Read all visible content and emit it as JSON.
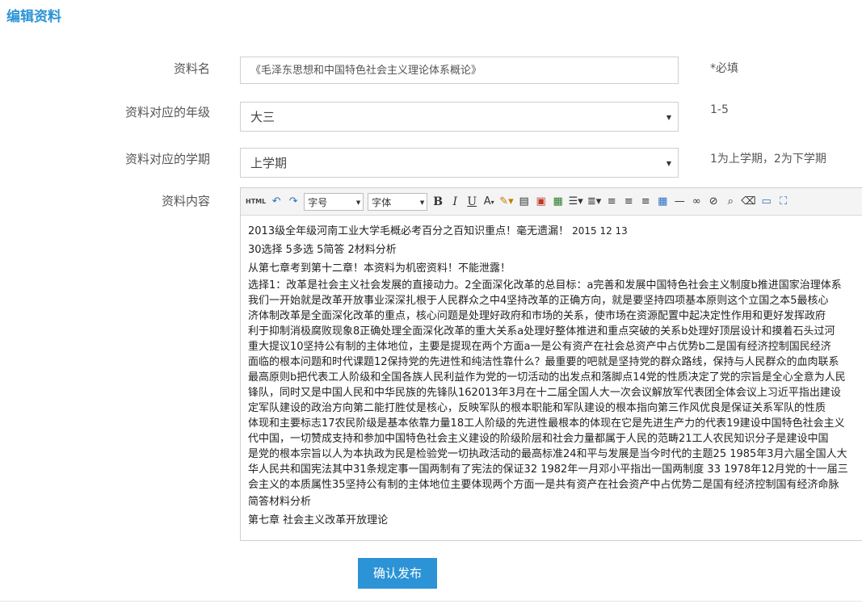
{
  "page": {
    "title": "编辑资料"
  },
  "form": {
    "name": {
      "label": "资料名",
      "value": "《毛泽东思想和中国特色社会主义理论体系概论》",
      "hint": "*必填"
    },
    "grade": {
      "label": "资料对应的年级",
      "value": "大三",
      "hint": "1-5"
    },
    "term": {
      "label": "资料对应的学期",
      "value": "上学期",
      "hint": "1为上学期，2为下学期"
    },
    "content": {
      "label": "资料内容"
    }
  },
  "editor": {
    "toolbar": {
      "html_label": "HTML",
      "font_size_label": "字号",
      "font_family_label": "字体",
      "bold_label": "B",
      "italic_label": "I",
      "underline_label": "U",
      "font_color_label": "A"
    },
    "header_line": {
      "text": "2013级全年级河南工业大学毛概必考百分之百知识重点！毫无遗漏！",
      "date": "2015 12 13"
    },
    "line2": "30选择  5多选  5简答  2材料分析",
    "line3": "从第七章考到第十二章！本资料为机密资料！不能泄露！",
    "paragraph_lines": [
      "选择1：改革是社会主义社会发展的直接动力。2全面深化改革的总目标：a完善和发展中国特色社会主义制度b推进国家治理体系",
      "我们一开始就是改革开放事业深深扎根于人民群众之中4坚持改革的正确方向，就是要坚持四项基本原则这个立国之本5最核心",
      "济体制改革是全面深化改革的重点，核心问题是处理好政府和市场的关系，使市场在资源配置中起决定性作用和更好发挥政府",
      "利于抑制消极腐败现象8正确处理全面深化改革的重大关系a处理好整体推进和重点突破的关系b处理好顶层设计和摸着石头过河",
      "重大提议10坚持公有制的主体地位，主要是提现在两个方面a一是公有资产在社会总资产中占优势b二是国有经济控制国民经济",
      "面临的根本问题和时代课题12保持党的先进性和纯洁性靠什么？最重要的吧就是坚持党的群众路线，保持与人民群众的血肉联系",
      "最高原则b把代表工人阶级和全国各族人民利益作为党的一切活动的出发点和落脚点14党的性质决定了党的宗旨是全心全意为人民",
      "锋队，同时又是中国人民和中华民族的先锋队162013年3月在十二届全国人大一次会议解放军代表团全体会议上习近平指出建设",
      "定军队建设的政治方向第二能打胜仗是核心，反映军队的根本职能和军队建设的根本指向第三作风优良是保证关系军队的性质",
      "体现和主要标志17农民阶级是基本依靠力量18工人阶级的先进性最根本的体现在它是先进生产力的代表19建设中国特色社会主义",
      "代中国，一切赞成支持和参加中国特色社会主义建设的阶级阶层和社会力量都属于人民的范畴21工人农民知识分子是建设中国",
      "是党的根本宗旨以人为本执政为民是检验党一切执政活动的最高标准24和平与发展是当今时代的主题25 1985年3月六届全国人大",
      "华人民共和国宪法其中31条规定事一国两制有了宪法的保证32 1982年一月邓小平指出一国两制度  33 1978年12月党的十一届三",
      "会主义的本质属性35坚持公有制的主体地位主要体现两个方面一是共有资产在社会资产中占优势二是国有经济控制国有经济命脉"
    ],
    "line_after": "简答材料分析",
    "chapter_line": "第七章  社会主义改革开放理论"
  },
  "submit_label": "确认发布",
  "colors": {
    "accent": "#2b93d6"
  },
  "icons": [
    "html-source-icon",
    "undo-icon",
    "redo-icon",
    "font-color-icon",
    "highlight-icon",
    "format-brush-icon",
    "image-icon",
    "insert-image-icon",
    "unordered-list-icon",
    "ordered-list-icon",
    "align-left-icon",
    "align-center-icon",
    "align-justify-icon",
    "table-icon",
    "horizontal-rule-icon",
    "link-icon",
    "unlink-icon",
    "find-icon",
    "eraser-icon",
    "template-icon",
    "fullscreen-icon"
  ]
}
